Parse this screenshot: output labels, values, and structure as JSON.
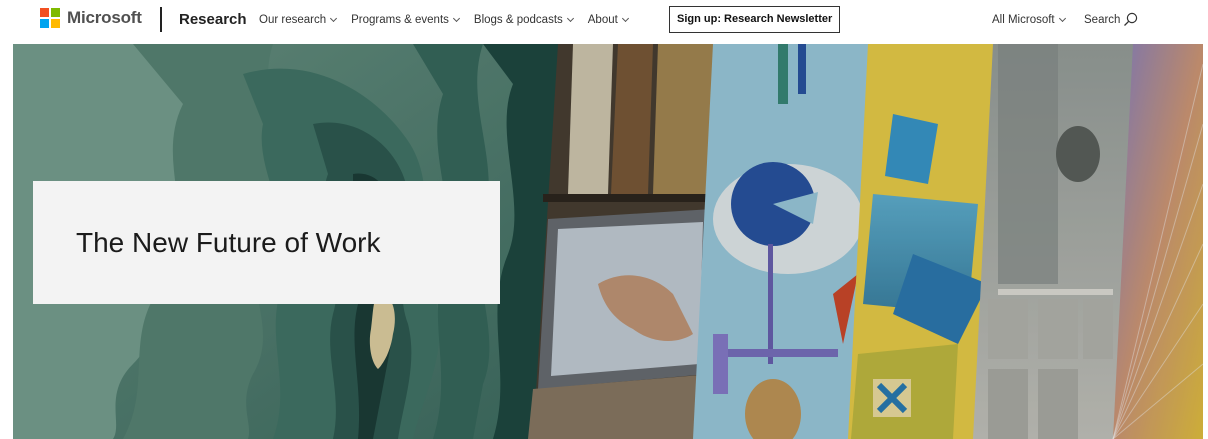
{
  "header": {
    "brand_name": "Microsoft",
    "site_name": "Research",
    "nav": [
      {
        "label": "Our research"
      },
      {
        "label": "Programs & events"
      },
      {
        "label": "Blogs & podcasts"
      },
      {
        "label": "About"
      }
    ],
    "newsletter_label": "Sign up: Research Newsletter",
    "all_microsoft_label": "All Microsoft",
    "search_label": "Search",
    "logo_colors": [
      "#f25022",
      "#7fba00",
      "#00a4ef",
      "#ffb900"
    ]
  },
  "hero": {
    "title": "The New Future of Work"
  },
  "icons": {
    "search": "search-icon",
    "chevron": "chevron-down-icon",
    "logo": "microsoft-logo-icon"
  }
}
